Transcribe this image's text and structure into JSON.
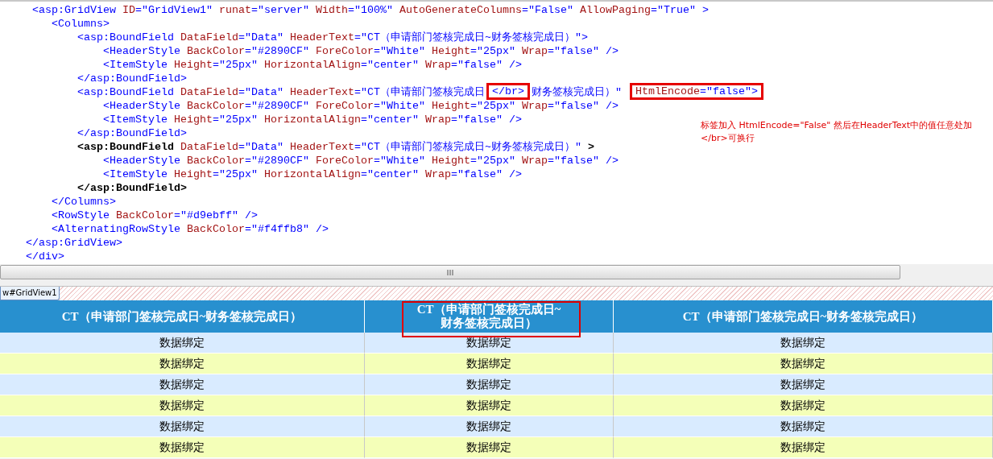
{
  "editor": {
    "lines": [
      {
        "tokens": [
          {
            "kind": "tag",
            "text": "     <asp:GridView"
          },
          {
            "kind": "attr",
            "text": " ID"
          },
          {
            "kind": "value",
            "text": "=\"GridView1\""
          },
          {
            "kind": "attr",
            "text": " runat"
          },
          {
            "kind": "value",
            "text": "=\"server\""
          },
          {
            "kind": "attr",
            "text": " Width"
          },
          {
            "kind": "value",
            "text": "=\"100%\""
          },
          {
            "kind": "attr",
            "text": " AutoGenerateColumns"
          },
          {
            "kind": "value",
            "text": "=\"False\""
          },
          {
            "kind": "attr",
            "text": " AllowPaging"
          },
          {
            "kind": "value",
            "text": "=\"True\""
          },
          {
            "kind": "tag",
            "text": " >"
          }
        ]
      },
      {
        "tokens": [
          {
            "kind": "tag",
            "text": "        <Columns>"
          }
        ]
      },
      {
        "tokens": [
          {
            "kind": "tag",
            "text": "            <asp:BoundField"
          },
          {
            "kind": "attr",
            "text": " DataField"
          },
          {
            "kind": "value",
            "text": "=\"Data\""
          },
          {
            "kind": "attr",
            "text": " HeaderText"
          },
          {
            "kind": "value",
            "text": "=\"CT（申请部门签核完成日~财务签核完成日）\""
          },
          {
            "kind": "tag",
            "text": ">"
          }
        ]
      },
      {
        "tokens": [
          {
            "kind": "tag",
            "text": "                <HeaderStyle"
          },
          {
            "kind": "attr",
            "text": " BackColor"
          },
          {
            "kind": "value",
            "text": "=\"#2890CF\""
          },
          {
            "kind": "attr",
            "text": " ForeColor"
          },
          {
            "kind": "value",
            "text": "=\"White\""
          },
          {
            "kind": "attr",
            "text": " Height"
          },
          {
            "kind": "value",
            "text": "=\"25px\""
          },
          {
            "kind": "attr",
            "text": " Wrap"
          },
          {
            "kind": "value",
            "text": "=\"false\""
          },
          {
            "kind": "tag",
            "text": " />"
          }
        ]
      },
      {
        "tokens": [
          {
            "kind": "tag",
            "text": "                <ItemStyle"
          },
          {
            "kind": "attr",
            "text": " Height"
          },
          {
            "kind": "value",
            "text": "=\"25px\""
          },
          {
            "kind": "attr",
            "text": " HorizontalAlign"
          },
          {
            "kind": "value",
            "text": "=\"center\""
          },
          {
            "kind": "attr",
            "text": " Wrap"
          },
          {
            "kind": "value",
            "text": "=\"false\""
          },
          {
            "kind": "tag",
            "text": " />"
          }
        ]
      },
      {
        "tokens": [
          {
            "kind": "tag",
            "text": "            </asp:BoundField>"
          }
        ]
      },
      {
        "tokens": [
          {
            "kind": "tag",
            "text": "            <asp:BoundField"
          },
          {
            "kind": "attr",
            "text": " DataField"
          },
          {
            "kind": "value",
            "text": "=\"Data\""
          },
          {
            "kind": "attr",
            "text": " HeaderText"
          },
          {
            "kind": "value",
            "text": "=\"CT（申请部门签核完成日"
          },
          {
            "kind": "highlight",
            "tokens": [
              {
                "kind": "value",
                "text": "</br>"
              }
            ]
          },
          {
            "kind": "value",
            "text": "财务签核完成日）\" "
          },
          {
            "kind": "highlight",
            "tokens": [
              {
                "kind": "attr",
                "text": "HtmlEncode"
              },
              {
                "kind": "value",
                "text": "=\"false\""
              },
              {
                "kind": "tag",
                "text": ">"
              }
            ]
          }
        ]
      },
      {
        "tokens": [
          {
            "kind": "tag",
            "text": "                <HeaderStyle"
          },
          {
            "kind": "attr",
            "text": " BackColor"
          },
          {
            "kind": "value",
            "text": "=\"#2890CF\""
          },
          {
            "kind": "attr",
            "text": " ForeColor"
          },
          {
            "kind": "value",
            "text": "=\"White\""
          },
          {
            "kind": "attr",
            "text": " Height"
          },
          {
            "kind": "value",
            "text": "=\"25px\""
          },
          {
            "kind": "attr",
            "text": " Wrap"
          },
          {
            "kind": "value",
            "text": "=\"false\""
          },
          {
            "kind": "tag",
            "text": " />"
          }
        ]
      },
      {
        "tokens": [
          {
            "kind": "tag",
            "text": "                <ItemStyle"
          },
          {
            "kind": "attr",
            "text": " Height"
          },
          {
            "kind": "value",
            "text": "=\"25px\""
          },
          {
            "kind": "attr",
            "text": " HorizontalAlign"
          },
          {
            "kind": "value",
            "text": "=\"center\""
          },
          {
            "kind": "attr",
            "text": " Wrap"
          },
          {
            "kind": "value",
            "text": "=\"false\""
          },
          {
            "kind": "tag",
            "text": " />"
          }
        ]
      },
      {
        "tokens": [
          {
            "kind": "tag",
            "text": "            </asp:BoundField>"
          }
        ]
      },
      {
        "tokens": [
          {
            "kind": "bold",
            "text": "            <asp:BoundField"
          },
          {
            "kind": "attr",
            "text": " DataField"
          },
          {
            "kind": "value",
            "text": "=\"Data\""
          },
          {
            "kind": "attr",
            "text": " HeaderText"
          },
          {
            "kind": "value",
            "text": "=\"CT（申请部门签核完成日~财务签核完成日）\""
          },
          {
            "kind": "bold",
            "text": " >"
          }
        ]
      },
      {
        "tokens": [
          {
            "kind": "tag",
            "text": "                <HeaderStyle"
          },
          {
            "kind": "attr",
            "text": " BackColor"
          },
          {
            "kind": "value",
            "text": "=\"#2890CF\""
          },
          {
            "kind": "attr",
            "text": " ForeColor"
          },
          {
            "kind": "value",
            "text": "=\"White\""
          },
          {
            "kind": "attr",
            "text": " Height"
          },
          {
            "kind": "value",
            "text": "=\"25px\""
          },
          {
            "kind": "attr",
            "text": " Wrap"
          },
          {
            "kind": "value",
            "text": "=\"false\""
          },
          {
            "kind": "tag",
            "text": " />"
          }
        ]
      },
      {
        "tokens": [
          {
            "kind": "tag",
            "text": "                <ItemStyle"
          },
          {
            "kind": "attr",
            "text": " Height"
          },
          {
            "kind": "value",
            "text": "=\"25px\""
          },
          {
            "kind": "attr",
            "text": " HorizontalAlign"
          },
          {
            "kind": "value",
            "text": "=\"center\""
          },
          {
            "kind": "attr",
            "text": " Wrap"
          },
          {
            "kind": "value",
            "text": "=\"false\""
          },
          {
            "kind": "tag",
            "text": " />"
          }
        ]
      },
      {
        "tokens": [
          {
            "kind": "bold",
            "text": "            </asp:BoundField>"
          }
        ]
      },
      {
        "tokens": [
          {
            "kind": "tag",
            "text": "        </Columns>"
          }
        ]
      },
      {
        "tokens": [
          {
            "kind": "tag",
            "text": "        <RowStyle"
          },
          {
            "kind": "attr",
            "text": " BackColor"
          },
          {
            "kind": "value",
            "text": "=\"#d9ebff\""
          },
          {
            "kind": "tag",
            "text": " />"
          }
        ]
      },
      {
        "tokens": [
          {
            "kind": "tag",
            "text": "        <AlternatingRowStyle"
          },
          {
            "kind": "attr",
            "text": " BackColor"
          },
          {
            "kind": "value",
            "text": "=\"#f4ffb8\""
          },
          {
            "kind": "tag",
            "text": " />"
          }
        ]
      },
      {
        "tokens": [
          {
            "kind": "tag",
            "text": "    </asp:GridView>"
          }
        ]
      },
      {
        "tokens": [
          {
            "kind": "tag",
            "text": "    </div>"
          }
        ]
      }
    ],
    "annotation": "标签加入 HtmlEncode=\"False\" 然后在HeaderText中的值任意处加</br>可换行"
  },
  "design_tab": {
    "label": "w#GridView1",
    "selected": true
  },
  "grid": {
    "columns": [
      {
        "lines": [
          "CT（申请部门签核完成日~财务签核完成日）"
        ],
        "highlighted": false
      },
      {
        "lines": [
          "CT（申请部门签核完成日~",
          "财务签核完成日）"
        ],
        "highlighted": true
      },
      {
        "lines": [
          "CT（申请部门签核完成日~财务签核完成日）"
        ],
        "highlighted": false
      }
    ],
    "rows": [
      {
        "alternating": false,
        "cells": [
          "数据绑定",
          "数据绑定",
          "数据绑定"
        ]
      },
      {
        "alternating": true,
        "cells": [
          "数据绑定",
          "数据绑定",
          "数据绑定"
        ]
      },
      {
        "alternating": false,
        "cells": [
          "数据绑定",
          "数据绑定",
          "数据绑定"
        ]
      },
      {
        "alternating": true,
        "cells": [
          "数据绑定",
          "数据绑定",
          "数据绑定"
        ]
      },
      {
        "alternating": false,
        "cells": [
          "数据绑定",
          "数据绑定",
          "数据绑定"
        ]
      },
      {
        "alternating": true,
        "cells": [
          "数据绑定",
          "数据绑定",
          "数据绑定"
        ]
      }
    ]
  }
}
